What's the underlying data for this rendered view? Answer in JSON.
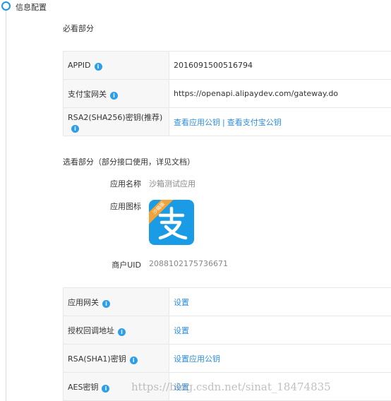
{
  "section": {
    "title": "信息配置"
  },
  "required": {
    "title": "必看部分",
    "rows": [
      {
        "label": "APPID",
        "value": "2016091500516794"
      },
      {
        "label": "支付宝网关",
        "value": "https://openapi.alipaydev.com/gateway.do"
      },
      {
        "label": "RSA2(SHA256)密钥(推荐)",
        "link1": "查看应用公钥",
        "separator": "|",
        "link2": "查看支付宝公钥"
      }
    ]
  },
  "optional": {
    "title": "选看部分（部分接口使用，详见文档）",
    "app_name_label": "应用名称",
    "app_name_value": "沙箱测试应用",
    "app_icon_label": "应用图标",
    "app_icon_ribbon": "沙箱版",
    "merchant_uid_label": "商户UID",
    "merchant_uid_value": "2088102175736671"
  },
  "config": {
    "rows": [
      {
        "label": "应用网关",
        "link": "设置"
      },
      {
        "label": "授权回调地址",
        "link": "设置"
      },
      {
        "label": "RSA(SHA1)密钥",
        "link": "设置应用公钥"
      },
      {
        "label": "AES密钥",
        "link": "设置"
      }
    ]
  },
  "watermark": "https://blog.csdn.net/sinat_18474835",
  "colors": {
    "accent": "#2d8ee3",
    "icon_blue": "#1a9be6",
    "ribbon": "#f0a23b"
  },
  "icons": {
    "info": "info-circle-icon",
    "app": "alipay-logo-icon"
  }
}
